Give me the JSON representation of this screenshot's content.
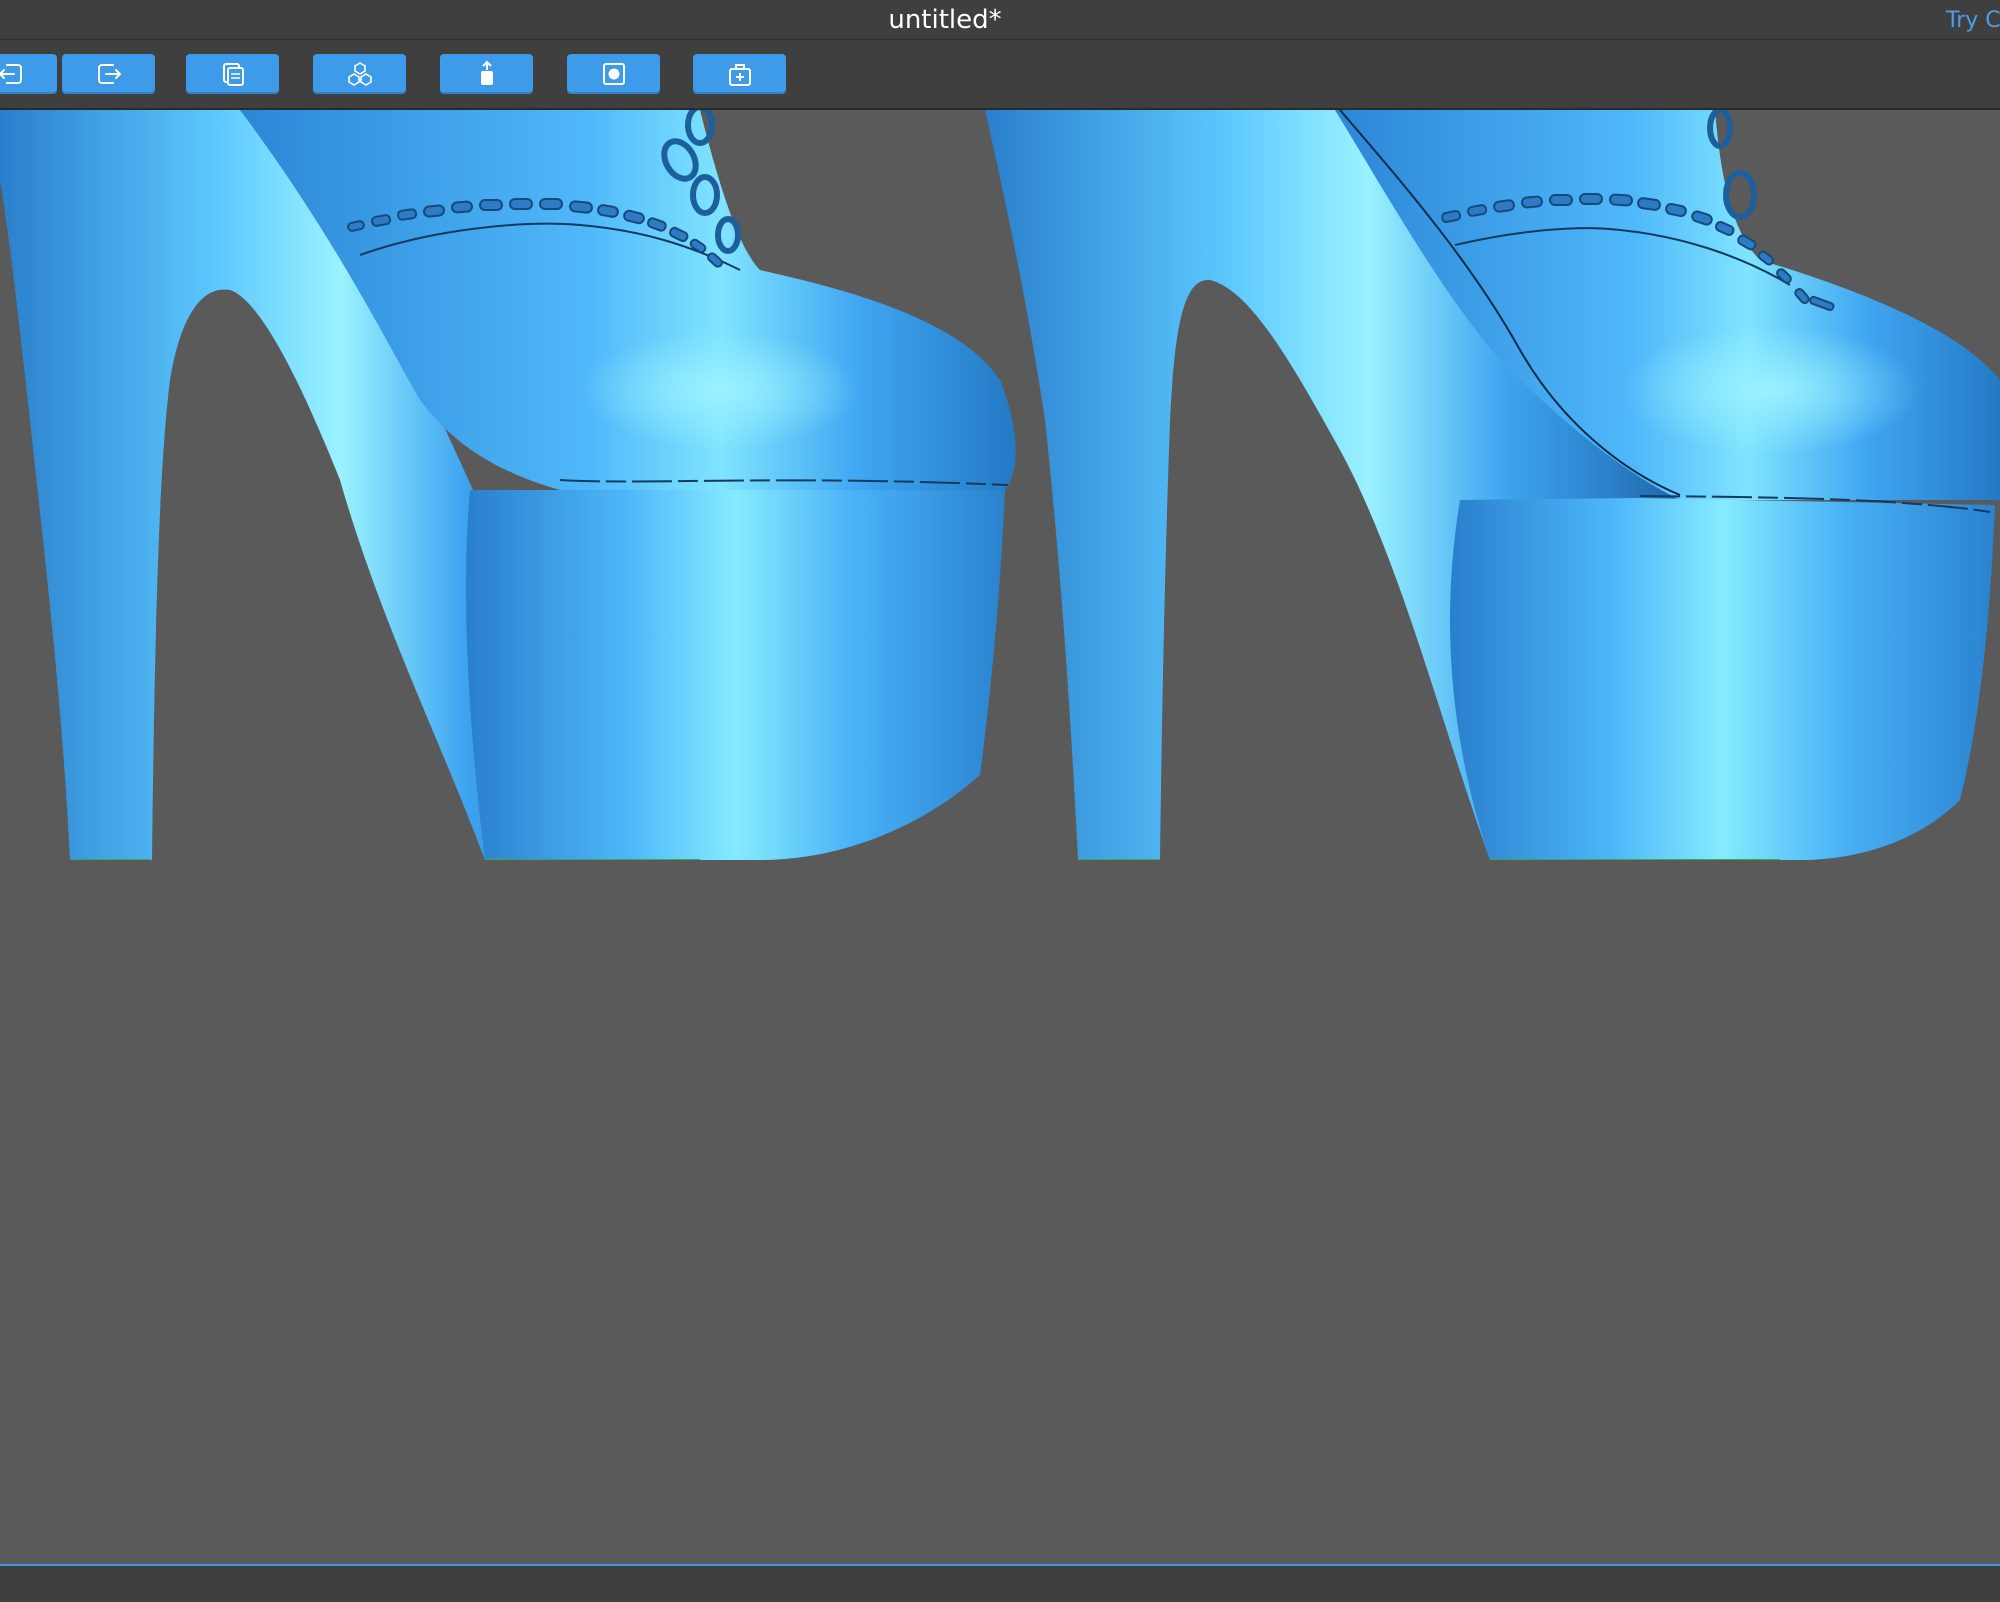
{
  "window": {
    "title": "untitled*",
    "promo_text": "Try Ch"
  },
  "toolbar": {
    "buttons": [
      {
        "name": "import-button",
        "icon": "import-icon"
      },
      {
        "name": "export-button",
        "icon": "export-icon"
      },
      {
        "name": "copy-button",
        "icon": "copy-icon"
      },
      {
        "name": "split-parts-button",
        "icon": "cubes-icon"
      },
      {
        "name": "extrude-button",
        "icon": "extrude-icon"
      },
      {
        "name": "hollow-button",
        "icon": "hollow-icon"
      },
      {
        "name": "add-support-button",
        "icon": "add-box-icon"
      }
    ]
  },
  "colors": {
    "accent": "#3d9be9",
    "panel": "#3f3f3f",
    "viewport": "#5a5a5a",
    "model": "#3c9ff0",
    "model_highlight": "#7fe6ff",
    "model_shadow": "#1d5f9c"
  }
}
